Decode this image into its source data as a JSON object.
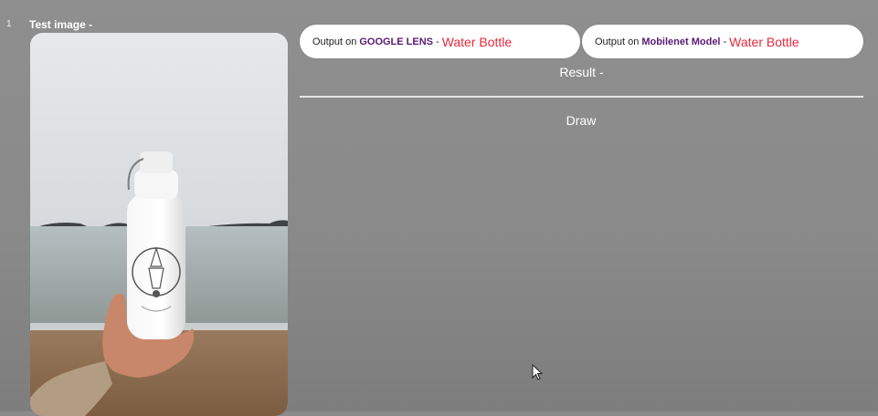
{
  "item_index": "1",
  "test_image_label": "Test image -",
  "results": [
    {
      "prefix": "Output on",
      "model": "GOOGLE LENS",
      "separator": "-",
      "result": "Water Bottle"
    },
    {
      "prefix": "Output on",
      "model": "Mobilenet Model",
      "separator": "-",
      "result": "Water Bottle"
    }
  ],
  "result_label": "Result -",
  "draw_button": "Draw",
  "colors": {
    "background": "#8a8a8a",
    "model_name": "#5a1a74",
    "result_text": "#e8293f",
    "pill": "#ffffff"
  }
}
